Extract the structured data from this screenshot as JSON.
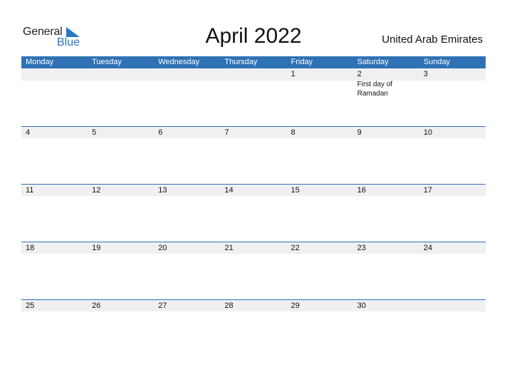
{
  "logo": {
    "general": "General",
    "blue": "Blue"
  },
  "title": "April 2022",
  "country": "United Arab Emirates",
  "colors": {
    "header": "#2e72b5",
    "logo_blue": "#2a78c6",
    "row_shade": "#f0f0f0"
  },
  "weekdays": [
    "Monday",
    "Tuesday",
    "Wednesday",
    "Thursday",
    "Friday",
    "Saturday",
    "Sunday"
  ],
  "weeks": [
    [
      {
        "d": ""
      },
      {
        "d": ""
      },
      {
        "d": ""
      },
      {
        "d": ""
      },
      {
        "d": "1"
      },
      {
        "d": "2",
        "event": "First day of Ramadan"
      },
      {
        "d": "3"
      }
    ],
    [
      {
        "d": "4"
      },
      {
        "d": "5"
      },
      {
        "d": "6"
      },
      {
        "d": "7"
      },
      {
        "d": "8"
      },
      {
        "d": "9"
      },
      {
        "d": "10"
      }
    ],
    [
      {
        "d": "11"
      },
      {
        "d": "12"
      },
      {
        "d": "13"
      },
      {
        "d": "14"
      },
      {
        "d": "15"
      },
      {
        "d": "16"
      },
      {
        "d": "17"
      }
    ],
    [
      {
        "d": "18"
      },
      {
        "d": "19"
      },
      {
        "d": "20"
      },
      {
        "d": "21"
      },
      {
        "d": "22"
      },
      {
        "d": "23"
      },
      {
        "d": "24"
      }
    ],
    [
      {
        "d": "25"
      },
      {
        "d": "26"
      },
      {
        "d": "27"
      },
      {
        "d": "28"
      },
      {
        "d": "29"
      },
      {
        "d": "30"
      },
      {
        "d": ""
      }
    ]
  ]
}
